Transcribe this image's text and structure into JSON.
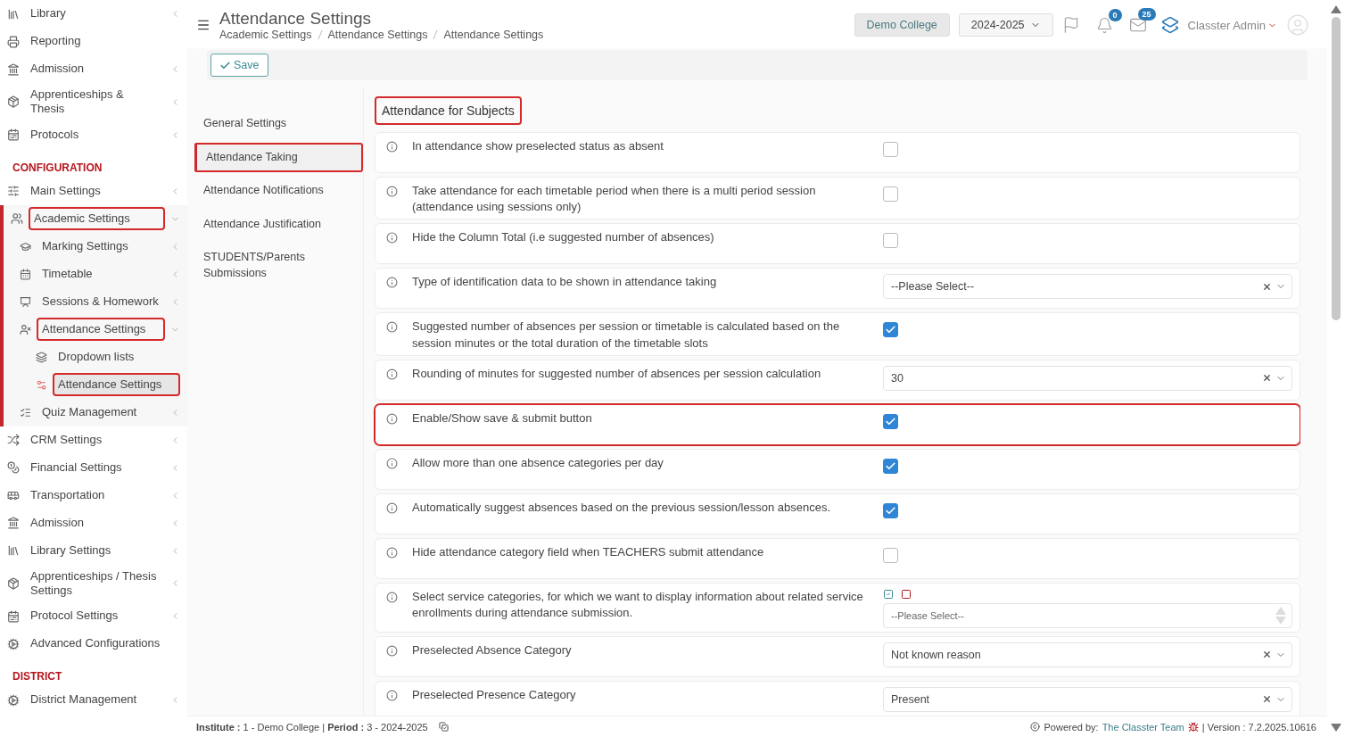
{
  "sidebar": {
    "items": [
      {
        "kind": "item",
        "label": "Library",
        "has_arrow": true
      },
      {
        "kind": "item",
        "label": "Reporting",
        "has_arrow": false
      },
      {
        "kind": "item",
        "label": "Admission",
        "has_arrow": true
      },
      {
        "kind": "item",
        "label": "Apprenticeships & Thesis",
        "has_arrow": true
      },
      {
        "kind": "item",
        "label": "Protocols",
        "has_arrow": true
      },
      {
        "kind": "section",
        "label": "CONFIGURATION"
      },
      {
        "kind": "item",
        "label": "Main Settings",
        "has_arrow": true
      },
      {
        "kind": "item",
        "label": "Academic Settings",
        "has_arrow": true,
        "expanded": true,
        "highlighted": true,
        "children": [
          {
            "label": "Marking Settings",
            "expanded": false,
            "highlighted": false,
            "selected": false
          },
          {
            "label": "Timetable",
            "expanded": false,
            "highlighted": false,
            "selected": false
          },
          {
            "label": "Sessions & Homework",
            "expanded": false,
            "highlighted": false,
            "selected": false
          },
          {
            "label": "Attendance Settings",
            "expanded": true,
            "highlighted": true,
            "selected": false,
            "children": [
              {
                "label": "Dropdown lists",
                "highlighted": false,
                "selected": false
              },
              {
                "label": "Attendance Settings",
                "highlighted": true,
                "selected": true
              }
            ]
          },
          {
            "label": "Quiz Management",
            "expanded": false,
            "highlighted": false,
            "selected": false
          }
        ]
      },
      {
        "kind": "item",
        "label": "CRM Settings",
        "has_arrow": true
      },
      {
        "kind": "item",
        "label": "Financial Settings",
        "has_arrow": true
      },
      {
        "kind": "item",
        "label": "Transportation",
        "has_arrow": true
      },
      {
        "kind": "item",
        "label": "Admission",
        "has_arrow": true
      },
      {
        "kind": "item",
        "label": "Library Settings",
        "has_arrow": true
      },
      {
        "kind": "item",
        "label": "Apprenticeships / Thesis Settings",
        "has_arrow": true
      },
      {
        "kind": "item",
        "label": "Protocol Settings",
        "has_arrow": true
      },
      {
        "kind": "item",
        "label": "Advanced Configurations",
        "has_arrow": false
      },
      {
        "kind": "section",
        "label": "DISTRICT"
      },
      {
        "kind": "item",
        "label": "District Management",
        "has_arrow": true
      }
    ]
  },
  "header": {
    "title": "Attendance Settings",
    "breadcrumb": [
      "Academic Settings",
      "Attendance Settings",
      "Attendance Settings"
    ],
    "institute_button": "Demo College",
    "year_select": "2024-2025",
    "notifications_badge": "0",
    "messages_badge": "25",
    "user_name": "Classter Admin"
  },
  "toolbar": {
    "save_button": "Save"
  },
  "tabs": [
    {
      "label": "General Settings",
      "selected": false,
      "highlighted": false
    },
    {
      "label": "Attendance Taking",
      "selected": true,
      "highlighted": true
    },
    {
      "label": "Attendance Notifications",
      "selected": false,
      "highlighted": false
    },
    {
      "label": "Attendance Justification",
      "selected": false,
      "highlighted": false
    },
    {
      "label": "STUDENTS/Parents Submissions",
      "selected": false,
      "highlighted": false
    }
  ],
  "section_title": {
    "text": "Attendance for Subjects",
    "highlighted": true
  },
  "settings": [
    {
      "kind": "checkbox",
      "label": "In attendance show preselected status as absent",
      "checked": false,
      "highlighted": false
    },
    {
      "kind": "checkbox",
      "label": "Take attendance for each timetable period when there is a multi period session (attendance using sessions only)",
      "checked": false,
      "highlighted": false
    },
    {
      "kind": "checkbox",
      "label": "Hide the Column Total (i.e suggested number of absences)",
      "checked": false,
      "highlighted": false
    },
    {
      "kind": "select",
      "label": "Type of identification data to be shown in attendance taking",
      "value": "--Please Select--",
      "highlighted": false
    },
    {
      "kind": "checkbox",
      "label": "Suggested number of absences per session or timetable is calculated based on the session minutes or the total duration of the timetable slots",
      "checked": true,
      "highlighted": false
    },
    {
      "kind": "select",
      "label": "Rounding of minutes for suggested number of absences per session calculation",
      "value": "30",
      "highlighted": false
    },
    {
      "kind": "checkbox",
      "label": "Enable/Show save & submit button",
      "checked": true,
      "highlighted": true
    },
    {
      "kind": "checkbox",
      "label": "Allow more than one absence categories per day",
      "checked": true,
      "highlighted": false
    },
    {
      "kind": "checkbox",
      "label": "Automatically suggest absences based on the previous session/lesson absences.",
      "checked": true,
      "highlighted": false
    },
    {
      "kind": "checkbox",
      "label": "Hide attendance category field when TEACHERS submit attendance",
      "checked": false,
      "highlighted": false
    },
    {
      "kind": "multiselect",
      "label": "Select service categories, for which we want to display information about related service enrollments during attendance submission.",
      "placeholder": "--Please Select--",
      "highlighted": false
    },
    {
      "kind": "select",
      "label": "Preselected Absence Category",
      "value": "Not known reason",
      "highlighted": false
    },
    {
      "kind": "select",
      "label": "Preselected Presence Category",
      "value": "Present",
      "highlighted": false
    }
  ],
  "footer": {
    "info": "**Institute :** 1 - Demo College | **Period :** 3 - 2024-2025",
    "powered_by": "Powered by:",
    "team_link": "The Classter Team",
    "version": "| Version : 7.2.2025.10616"
  }
}
